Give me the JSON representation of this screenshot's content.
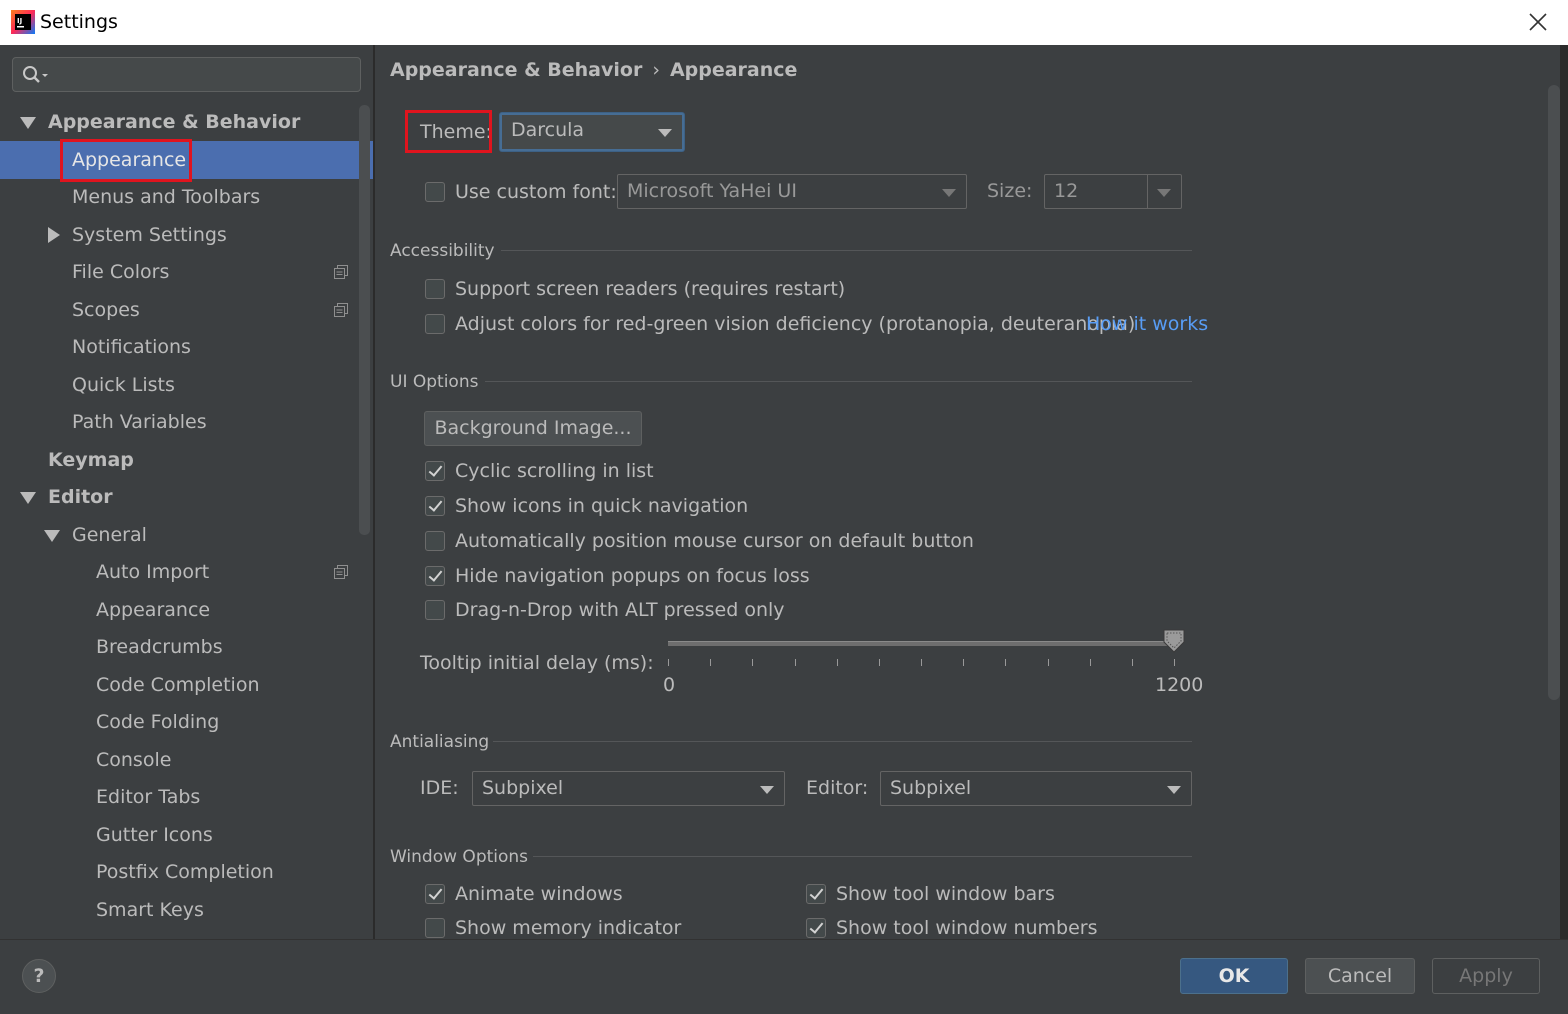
{
  "window": {
    "title": "Settings"
  },
  "sidebar": {
    "search_placeholder": "",
    "items": [
      {
        "label": "Appearance & Behavior",
        "level": 0,
        "expanded": true,
        "bold": true
      },
      {
        "label": "Appearance",
        "level": 1,
        "selected": true
      },
      {
        "label": "Menus and Toolbars",
        "level": 1
      },
      {
        "label": "System Settings",
        "level": 1,
        "expandable": true
      },
      {
        "label": "File Colors",
        "level": 1,
        "project_icon": true
      },
      {
        "label": "Scopes",
        "level": 1,
        "project_icon": true
      },
      {
        "label": "Notifications",
        "level": 1
      },
      {
        "label": "Quick Lists",
        "level": 1
      },
      {
        "label": "Path Variables",
        "level": 1
      },
      {
        "label": "Keymap",
        "level": 0,
        "bold": true
      },
      {
        "label": "Editor",
        "level": 0,
        "expanded": true,
        "bold": true
      },
      {
        "label": "General",
        "level": 1,
        "expanded": true
      },
      {
        "label": "Auto Import",
        "level": 2,
        "project_icon": true
      },
      {
        "label": "Appearance",
        "level": 2
      },
      {
        "label": "Breadcrumbs",
        "level": 2
      },
      {
        "label": "Code Completion",
        "level": 2
      },
      {
        "label": "Code Folding",
        "level": 2
      },
      {
        "label": "Console",
        "level": 2
      },
      {
        "label": "Editor Tabs",
        "level": 2
      },
      {
        "label": "Gutter Icons",
        "level": 2
      },
      {
        "label": "Postfix Completion",
        "level": 2
      },
      {
        "label": "Smart Keys",
        "level": 2
      }
    ]
  },
  "breadcrumb": {
    "parent": "Appearance & Behavior",
    "separator": "›",
    "current": "Appearance"
  },
  "theme": {
    "label": "Theme:",
    "value": "Darcula"
  },
  "custom_font": {
    "label": "Use custom font:",
    "checked": false,
    "font_value": "Microsoft YaHei UI",
    "size_label": "Size:",
    "size_value": "12"
  },
  "accessibility": {
    "title": "Accessibility",
    "screen_readers": {
      "label": "Support screen readers (requires restart)",
      "checked": false
    },
    "color_deficiency": {
      "label": "Adjust colors for red-green vision deficiency (protanopia, deuteranopia)",
      "checked": false
    },
    "how_it_works": "How it works"
  },
  "ui_options": {
    "title": "UI Options",
    "background_image_button": "Background Image...",
    "checkboxes": [
      {
        "label": "Cyclic scrolling in list",
        "checked": true
      },
      {
        "label": "Show icons in quick navigation",
        "checked": true
      },
      {
        "label": "Automatically position mouse cursor on default button",
        "checked": false
      },
      {
        "label": "Hide navigation popups on focus loss",
        "checked": true
      },
      {
        "label": "Drag-n-Drop with ALT pressed only",
        "checked": false
      }
    ],
    "tooltip": {
      "label": "Tooltip initial delay (ms):",
      "min": "0",
      "max": "1200",
      "value": 1200
    }
  },
  "antialiasing": {
    "title": "Antialiasing",
    "ide_label": "IDE:",
    "ide_value": "Subpixel",
    "editor_label": "Editor:",
    "editor_value": "Subpixel"
  },
  "window_options": {
    "title": "Window Options",
    "left": [
      {
        "label": "Animate windows",
        "checked": true
      },
      {
        "label": "Show memory indicator",
        "checked": false
      }
    ],
    "right": [
      {
        "label": "Show tool window bars",
        "checked": true
      },
      {
        "label": "Show tool window numbers",
        "checked": true
      }
    ]
  },
  "buttons": {
    "help": "?",
    "ok": "OK",
    "cancel": "Cancel",
    "apply": "Apply"
  },
  "colors": {
    "background": "#3c3f41",
    "selection": "#4b6eaf",
    "ok_button": "#365880",
    "link": "#589df6",
    "highlight_outline": "#e0141e"
  }
}
